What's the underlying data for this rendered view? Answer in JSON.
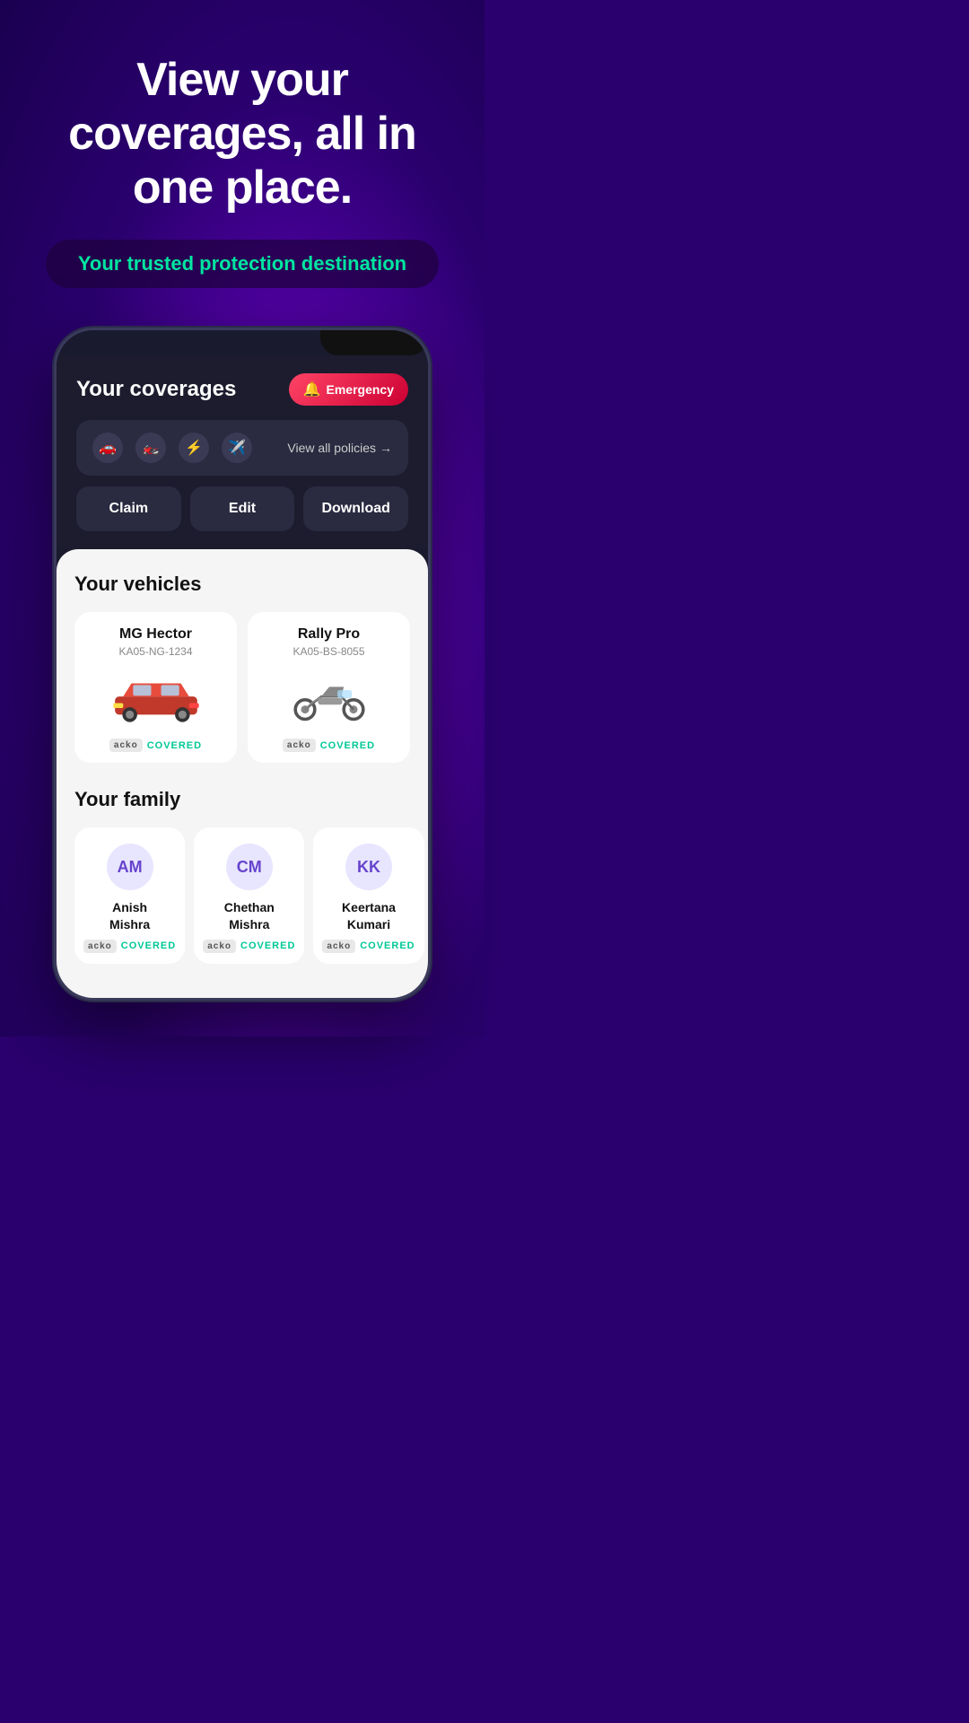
{
  "hero": {
    "title": "View your coverages, all in one place.",
    "subtitle": "Your trusted protection destination"
  },
  "phone": {
    "header": {
      "title": "Your coverages",
      "emergency_label": "Emergency",
      "emergency_icon": "🔔"
    },
    "policy_bar": {
      "view_all_label": "View all policies",
      "icons": [
        "🚗",
        "🏍️",
        "⚡",
        "✈️"
      ]
    },
    "actions": [
      {
        "label": "Claim"
      },
      {
        "label": "Edit"
      },
      {
        "label": "Download"
      }
    ],
    "vehicles_section": {
      "title": "Your vehicles",
      "vehicles": [
        {
          "name": "MG Hector",
          "plate": "KA05-NG-1234",
          "type": "car",
          "covered": true
        },
        {
          "name": "Rally Pro",
          "plate": "KA05-BS-8055",
          "type": "motorcycle",
          "covered": true
        }
      ]
    },
    "family_section": {
      "title": "Your family",
      "members": [
        {
          "initials": "AM",
          "name": "Anish\nMishra",
          "covered": true
        },
        {
          "initials": "CM",
          "name": "Chethan\nMishra",
          "covered": true
        },
        {
          "initials": "KK",
          "name": "Keertana\nKumari",
          "covered": true
        }
      ]
    },
    "covered_text": "COVERED",
    "acko_text": "acko"
  }
}
